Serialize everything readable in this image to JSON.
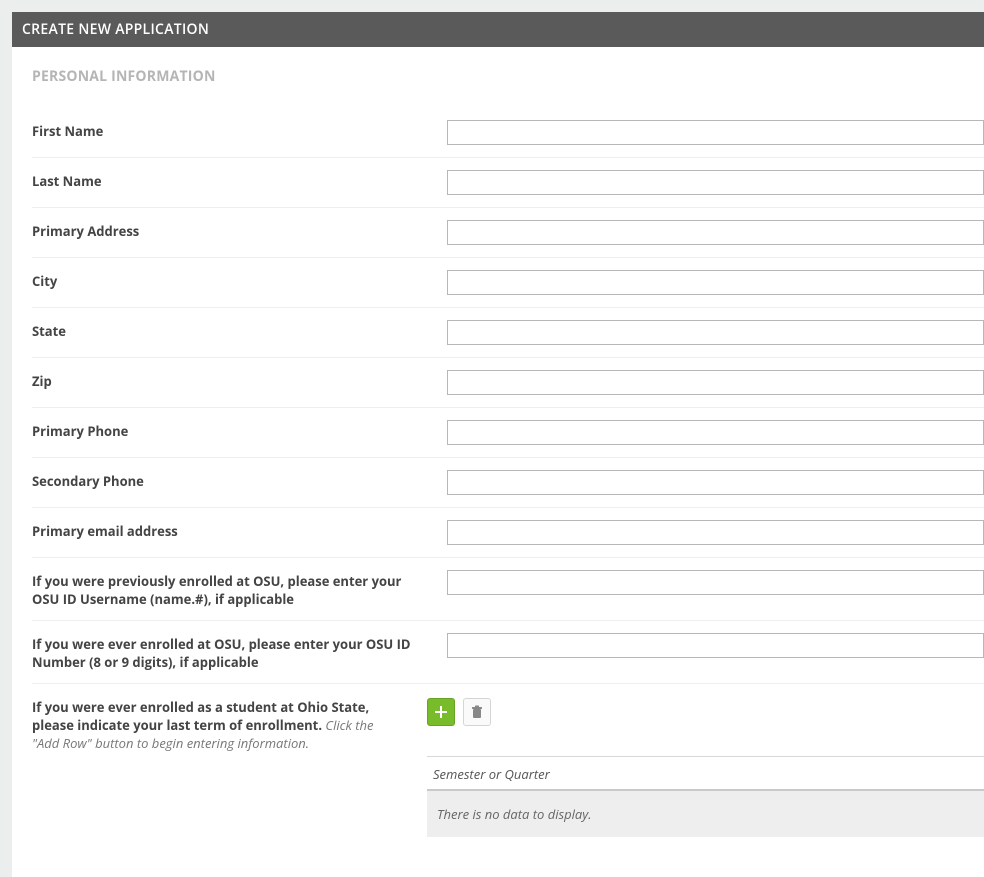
{
  "header": {
    "title": "CREATE NEW APPLICATION"
  },
  "section": {
    "title": "PERSONAL INFORMATION"
  },
  "fields": {
    "first_name": {
      "label": "First Name",
      "value": ""
    },
    "last_name": {
      "label": "Last Name",
      "value": ""
    },
    "address": {
      "label": "Primary Address",
      "value": ""
    },
    "city": {
      "label": "City",
      "value": ""
    },
    "state": {
      "label": "State",
      "value": ""
    },
    "zip": {
      "label": "Zip",
      "value": ""
    },
    "primary_phone": {
      "label": "Primary Phone",
      "value": ""
    },
    "secondary_phone": {
      "label": "Secondary Phone",
      "value": ""
    },
    "primary_email": {
      "label": "Primary email address",
      "value": ""
    },
    "osu_username": {
      "label": "If you were previously enrolled at OSU, please enter your OSU ID Username (name.#), if applicable",
      "value": ""
    },
    "osu_id": {
      "label": "If you were ever enrolled at OSU, please enter your OSU ID Number (8 or 9 digits), if applicable",
      "value": ""
    }
  },
  "last_term": {
    "label_bold": "If you were ever enrolled as a student at Ohio State, please indicate your last term of enrollment.",
    "label_hint": " Click the \"Add Row\" button to begin entering information.",
    "grid": {
      "column": "Semester or Quarter",
      "empty": "There is no data to display."
    }
  }
}
